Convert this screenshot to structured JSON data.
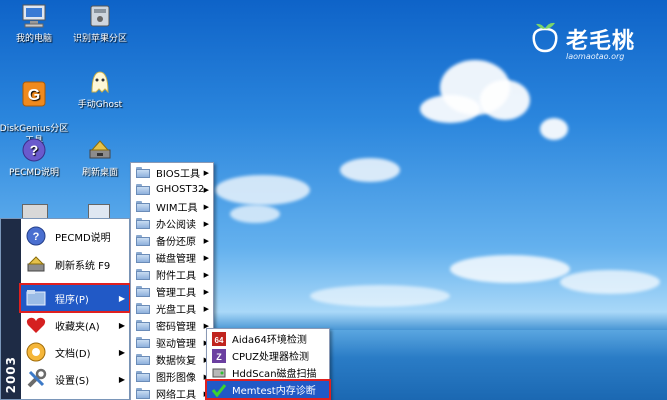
{
  "desktop": {
    "icons": [
      {
        "label": "我的电脑",
        "icon": "computer-icon"
      },
      {
        "label": "识别苹果分区",
        "icon": "drive-icon"
      },
      {
        "label": "DiskGenius分区\n工具",
        "icon": "diskgenius-icon"
      },
      {
        "label": "手动Ghost",
        "icon": "ghost-icon"
      },
      {
        "label": "PECMD说明",
        "icon": "help-icon"
      },
      {
        "label": "刷新桌面",
        "icon": "refresh-icon"
      }
    ],
    "logo": {
      "text": "老毛桃",
      "url": "laomaotao.org"
    }
  },
  "start_menu": {
    "side_text": "2003",
    "items": [
      {
        "label": "PECMD说明",
        "icon": "help-icon"
      },
      {
        "label": "刷新系统 F9",
        "icon": "refresh-icon"
      },
      {
        "label": "程序(P)",
        "icon": "programs-folder-icon",
        "arrow": "▶"
      },
      {
        "label": "收藏夹(A)",
        "icon": "favorites-heart-icon",
        "arrow": "▶"
      },
      {
        "label": "文档(D)",
        "icon": "documents-icon",
        "arrow": "▶"
      },
      {
        "label": "设置(S)",
        "icon": "settings-icon",
        "arrow": "▶"
      }
    ]
  },
  "programs_menu": {
    "items": [
      {
        "label": "BIOS工具",
        "arrow": "▶"
      },
      {
        "label": "GHOST32",
        "arrow": "▶"
      },
      {
        "label": "WIM工具",
        "arrow": "▶"
      },
      {
        "label": "办公阅读",
        "arrow": "▶"
      },
      {
        "label": "备份还原",
        "arrow": "▶"
      },
      {
        "label": "磁盘管理",
        "arrow": "▶"
      },
      {
        "label": "附件工具",
        "arrow": "▶"
      },
      {
        "label": "管理工具",
        "arrow": "▶"
      },
      {
        "label": "光盘工具",
        "arrow": "▶"
      },
      {
        "label": "密码管理",
        "arrow": "▶"
      },
      {
        "label": "驱动管理",
        "arrow": "▶"
      },
      {
        "label": "数据恢复",
        "arrow": "▶"
      },
      {
        "label": "图形图像",
        "arrow": "▶"
      },
      {
        "label": "网络工具",
        "arrow": "▶"
      }
    ]
  },
  "diagnostics_menu": {
    "items": [
      {
        "label": "Aida64环境检测",
        "icon": "aida64-icon"
      },
      {
        "label": "CPUZ处理器检测",
        "icon": "cpuz-icon"
      },
      {
        "label": "HddScan磁盘扫描",
        "icon": "hddscan-icon"
      },
      {
        "label": "Memtest内存诊断",
        "icon": "memtest-check-icon"
      }
    ]
  }
}
